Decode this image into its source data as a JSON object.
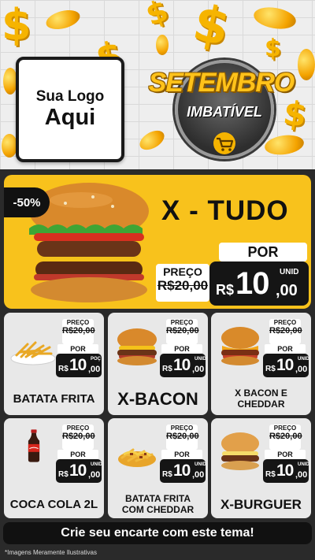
{
  "header": {
    "logo_line1": "Sua Logo",
    "logo_line2": "Aqui",
    "campaign_title": "SETEMBRO",
    "campaign_subtitle": "IMBATÍVEL",
    "icon": "shopping-cart-icon"
  },
  "featured": {
    "discount": "-50%",
    "name": "X - TUDO",
    "price_label": "PREÇO",
    "old_price": "R$20,00",
    "por_label": "POR",
    "currency": "R$",
    "price_integer": "10",
    "price_decimal": ",00",
    "unit": "UNID"
  },
  "products": [
    {
      "name": "BATATA FRITA",
      "price_label": "PREÇO",
      "old_price": "R$20,00",
      "por_label": "POR",
      "currency": "R$",
      "price_integer": "10",
      "price_decimal": ",00",
      "unit": "POÇ"
    },
    {
      "name": "X-BACON",
      "price_label": "PREÇO",
      "old_price": "R$20,00",
      "por_label": "POR",
      "currency": "R$",
      "price_integer": "10",
      "price_decimal": ",00",
      "unit": "UNID"
    },
    {
      "name": "X BACON E CHEDDAR",
      "price_label": "PREÇO",
      "old_price": "R$20,00",
      "por_label": "POR",
      "currency": "R$",
      "price_integer": "10",
      "price_decimal": ",00",
      "unit": "UNID"
    },
    {
      "name": "COCA COLA 2L",
      "price_label": "PREÇO",
      "old_price": "R$20,00",
      "por_label": "POR",
      "currency": "R$",
      "price_integer": "10",
      "price_decimal": ",00",
      "unit": "UNID"
    },
    {
      "name": "BATATA FRITA COM CHEDDAR",
      "price_label": "PREÇO",
      "old_price": "R$20,00",
      "por_label": "POR",
      "currency": "R$",
      "price_integer": "10",
      "price_decimal": ",00",
      "unit": "UNID"
    },
    {
      "name": "X-BURGUER",
      "price_label": "PREÇO",
      "old_price": "R$20,00",
      "por_label": "POR",
      "currency": "R$",
      "price_integer": "10",
      "price_decimal": ",00",
      "unit": "UNID"
    }
  ],
  "footer": {
    "cta": "Crie seu encarte com este tema!",
    "disclaimer": "*Imagens Meramente Ilustrativas"
  },
  "colors": {
    "accent_yellow": "#f8c21c",
    "dark": "#151515",
    "card_bg": "#e8e8e8",
    "background": "#2a2a2a"
  }
}
